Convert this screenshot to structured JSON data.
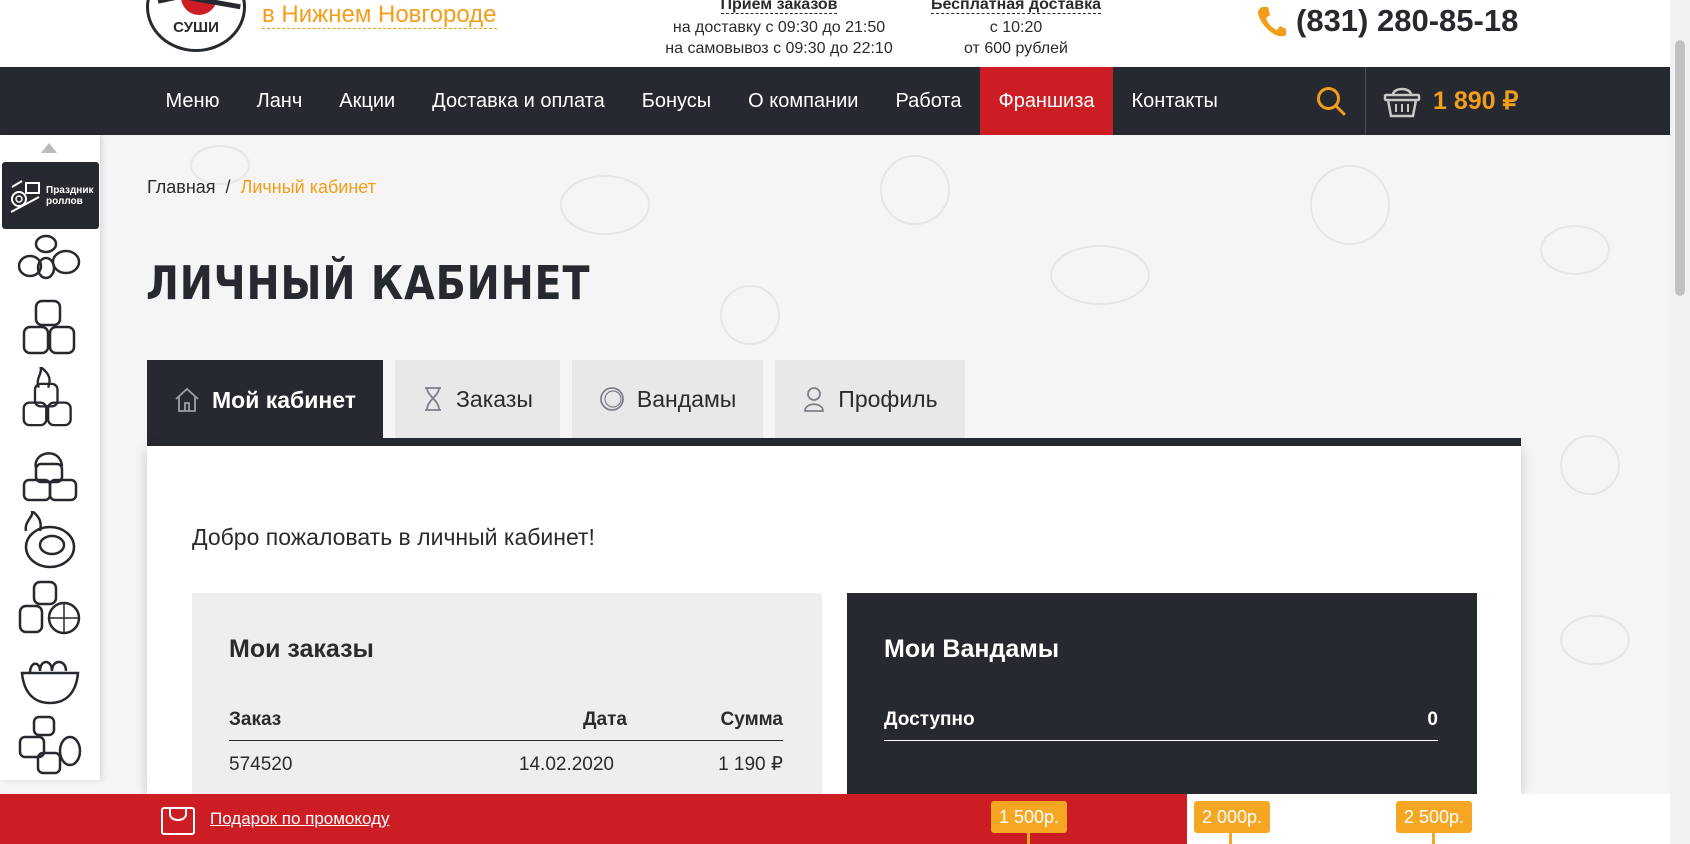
{
  "header": {
    "logo_text": "СУШИ",
    "city": "в Нижнем Новгороде",
    "orders_hours": {
      "title": "Прием заказов",
      "line1": "на доставку с 09:30 до 21:50",
      "line2": "на самовывоз с 09:30 до 22:10"
    },
    "free_delivery": {
      "title": "Бесплатная доставка",
      "line1": "с 10:20",
      "line2": "от 600 рублей"
    },
    "phone": "(831) 280-85-18"
  },
  "nav": {
    "items": [
      {
        "label": "Меню"
      },
      {
        "label": "Ланч"
      },
      {
        "label": "Акции"
      },
      {
        "label": "Доставка и оплата"
      },
      {
        "label": "Бонусы"
      },
      {
        "label": "О компании"
      },
      {
        "label": "Работа"
      },
      {
        "label": "Франшиза",
        "active": true
      },
      {
        "label": "Контакты"
      }
    ],
    "cart_amount": "1 890 ₽",
    "active_color": "#cc1d24",
    "bar_color": "#26292f",
    "accent_color": "#f29e1a"
  },
  "rail": {
    "promo_label_line1": "Праздник",
    "promo_label_line2": "роллов",
    "categories": [
      "rolls-set-icon",
      "rolls-stack-icon",
      "hot-rolls-icon",
      "gunkan-icon",
      "baked-roll-icon",
      "fruit-rolls-icon",
      "noodles-bowl-icon",
      "mini-rolls-icon"
    ]
  },
  "breadcrumb": {
    "home": "Главная",
    "separator": "/",
    "current": "Личный кабинет"
  },
  "page_title": "ЛИЧНЫЙ КАБИНЕТ",
  "tabs": [
    {
      "label": "Мой кабинет",
      "icon": "home-icon",
      "active": true
    },
    {
      "label": "Заказы",
      "icon": "hourglass-icon"
    },
    {
      "label": "Вандамы",
      "icon": "coin-icon"
    },
    {
      "label": "Профиль",
      "icon": "user-icon"
    }
  ],
  "cabinet": {
    "welcome": "Добро пожаловать в личный кабинет!",
    "orders": {
      "title": "Мои заказы",
      "headers": {
        "order": "Заказ",
        "date": "Дата",
        "sum": "Сумма"
      },
      "rows": [
        {
          "order": "574520",
          "date": "14.02.2020",
          "sum": "1 190 ₽"
        }
      ]
    },
    "wandams": {
      "title": "Мои Вандамы",
      "available_label": "Доступно",
      "available_value": "0"
    }
  },
  "promo_bar": {
    "link": "Подарок по промокоду",
    "thresholds": [
      "1 500р.",
      "2 000р.",
      "2 500р."
    ]
  }
}
